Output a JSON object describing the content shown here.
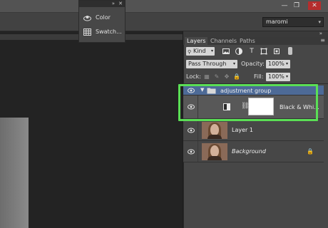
{
  "window": {
    "minimize": "—",
    "restore": "❐",
    "close": "✕"
  },
  "workspace": {
    "value": "maromi",
    "chevron": "▾"
  },
  "floating_panel": {
    "collapse": "»",
    "close": "✕",
    "items": [
      {
        "label": "Color",
        "icon": "color-icon"
      },
      {
        "label": "Swatch...",
        "icon": "swatches-icon"
      }
    ]
  },
  "layers_panel": {
    "collapse": "»",
    "tabs": [
      {
        "label": "Layers",
        "active": true
      },
      {
        "label": "Channels",
        "active": false
      },
      {
        "label": "Paths",
        "active": false
      }
    ],
    "menu": "≡",
    "filter": {
      "kind_label": "Kind",
      "icons": [
        "image-filter-icon",
        "adjustment-filter-icon",
        "type-filter-icon",
        "shape-filter-icon",
        "smart-object-filter-icon"
      ]
    },
    "blend": {
      "mode": "Pass Through",
      "opacity_label": "Opacity:",
      "opacity_value": "100%"
    },
    "lock": {
      "label": "Lock:",
      "fill_label": "Fill:",
      "fill_value": "100%"
    },
    "layers": [
      {
        "name": "adjustment group",
        "type": "group",
        "selected": true
      },
      {
        "name": "Black & Whi...",
        "type": "adjustment"
      },
      {
        "name": "Layer 1",
        "type": "pixel"
      },
      {
        "name": "Background",
        "type": "background",
        "locked": true
      }
    ]
  },
  "colors": {
    "selection": "#4d6a97",
    "highlight": "#5adf55",
    "panel": "#474747"
  }
}
